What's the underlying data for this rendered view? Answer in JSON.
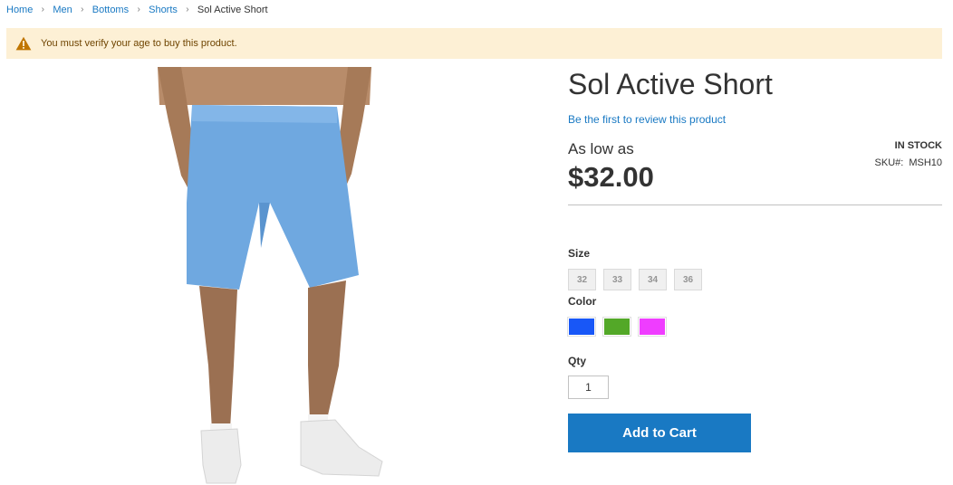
{
  "breadcrumbs": {
    "items": [
      "Home",
      "Men",
      "Bottoms",
      "Shorts"
    ],
    "current": "Sol Active Short",
    "separator": "›"
  },
  "notice": {
    "icon": "warning-icon",
    "text": "You must verify your age to buy this product."
  },
  "product": {
    "title": "Sol Active Short",
    "review_link": "Be the first to review this product",
    "price_label": "As low as",
    "price": "$32.00",
    "stock": "In stock",
    "sku_label": "SKU#:",
    "sku": "MSH10"
  },
  "options": {
    "size_label": "Size",
    "sizes": [
      "32",
      "33",
      "34",
      "36"
    ],
    "color_label": "Color",
    "colors": [
      "#1857f7",
      "#53a828",
      "#ef3dff"
    ]
  },
  "qty": {
    "label": "Qty",
    "value": "1"
  },
  "actions": {
    "add_to_cart": "Add to Cart"
  },
  "image": {
    "subject": "man wearing light blue athletic shorts and white sneakers"
  }
}
